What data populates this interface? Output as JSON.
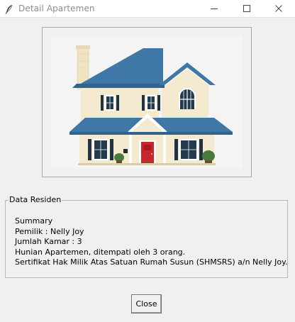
{
  "window": {
    "title": "Detail Apartemen",
    "icon": "feather-icon"
  },
  "image": {
    "subject": "house-illustration",
    "colors": {
      "roof": "#3f78a6",
      "wall": "#f3ead0",
      "trim": "#ffffff",
      "door": "#c8252c",
      "shutter": "#1e3445",
      "chimney": "#efe3c2"
    }
  },
  "group": {
    "label": "Data Residen",
    "lines": [
      "Summary",
      "Pemilik : Nelly Joy",
      "Jumlah Kamar : 3",
      "Hunian Apartemen, ditempati oleh 3 orang.",
      "Sertifikat Hak Milik Atas Satuan Rumah Susun (SHMSRS) a/n Nelly Joy."
    ]
  },
  "buttons": {
    "close_label": "Close"
  }
}
